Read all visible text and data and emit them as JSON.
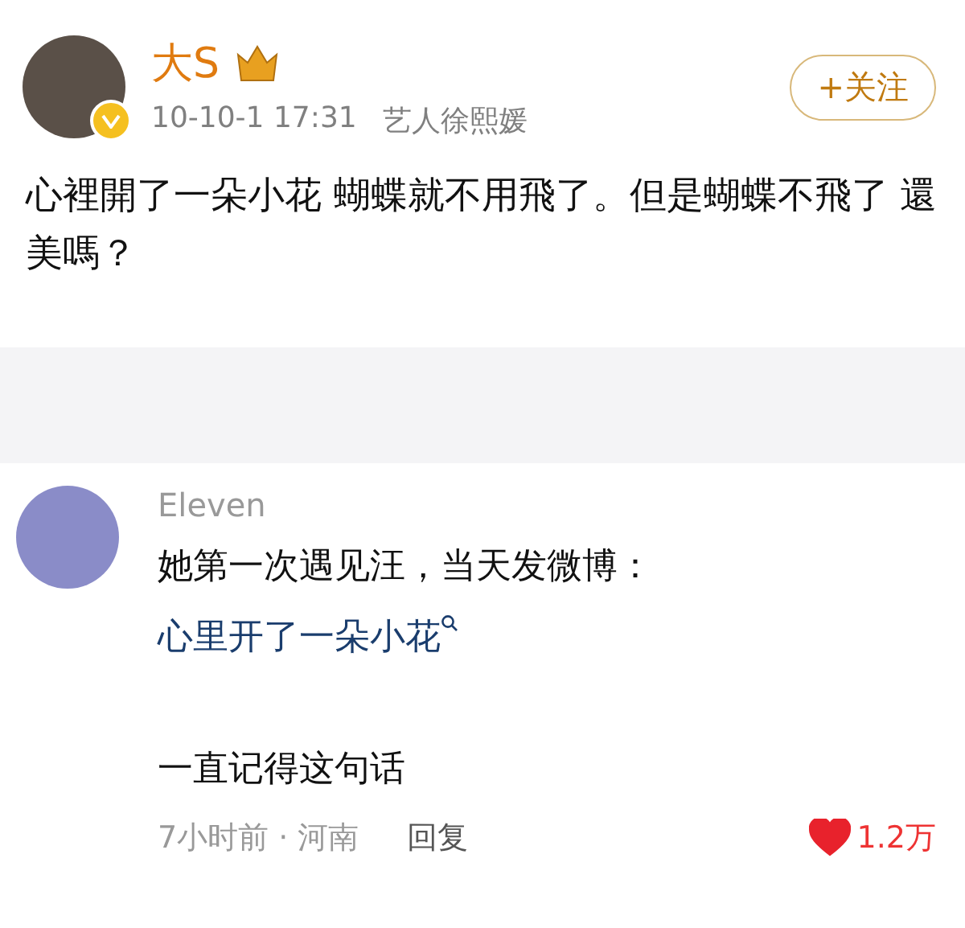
{
  "post": {
    "author": "大S",
    "verified": true,
    "time": "10-10-1 17:31",
    "source": "艺人徐熙媛",
    "follow_button": "+关注",
    "text": "心裡開了一朵小花 蝴蝶就不用飛了。但是蝴蝶不飛了 還美嗎？"
  },
  "comment": {
    "author": "Eleven",
    "lines": [
      {
        "kind": "text",
        "text": "她第一次遇见汪，当天发微博："
      },
      {
        "kind": "link",
        "text": "心里开了一朵小花"
      },
      {
        "kind": "text",
        "text": "一直记得这句话"
      }
    ],
    "time": "7小时前 · 河南",
    "reply": "回复",
    "likes": "1.2万",
    "liked": true
  }
}
